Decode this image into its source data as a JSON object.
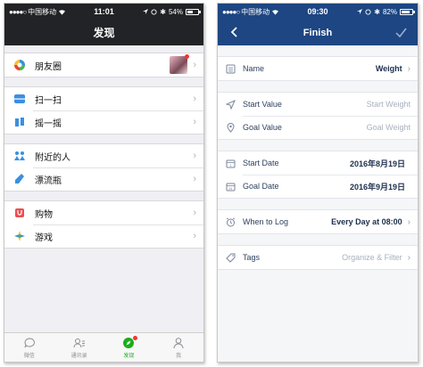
{
  "left_phone": {
    "status": {
      "carrier": "中国移动",
      "time": "11:01",
      "battery": "54%",
      "battery_level": 0.54
    },
    "title": "发现",
    "groups": [
      {
        "items": [
          {
            "label": "朋友圈",
            "icon": "moments-icon",
            "has_avatar": true
          }
        ]
      },
      {
        "items": [
          {
            "label": "扫一扫",
            "icon": "scan-icon"
          },
          {
            "label": "摇一摇",
            "icon": "shake-icon"
          }
        ]
      },
      {
        "items": [
          {
            "label": "附近的人",
            "icon": "nearby-people-icon"
          },
          {
            "label": "漂流瓶",
            "icon": "drift-bottle-icon"
          }
        ]
      },
      {
        "items": [
          {
            "label": "购物",
            "icon": "shopping-icon"
          },
          {
            "label": "游戏",
            "icon": "games-icon"
          }
        ]
      }
    ],
    "tabs": [
      {
        "label": "微信",
        "icon": "chat-bubble-icon",
        "active": false
      },
      {
        "label": "通讯录",
        "icon": "contacts-icon",
        "active": false
      },
      {
        "label": "发现",
        "icon": "compass-icon",
        "active": true,
        "badge": true
      },
      {
        "label": "我",
        "icon": "person-icon",
        "active": false
      }
    ],
    "colors": {
      "nav": "#222326",
      "accent": "#1aad19",
      "badge": "#f43530"
    }
  },
  "right_phone": {
    "status": {
      "carrier": "中国移动",
      "time": "09:30",
      "battery": "82%",
      "battery_level": 0.82
    },
    "title": "Finish",
    "back_icon": "chevron-left-icon",
    "done_icon": "checkmark-icon",
    "name_row": {
      "label": "Name",
      "value": "Weight"
    },
    "start_value": {
      "label": "Start Value",
      "placeholder": "Start Weight"
    },
    "goal_value": {
      "label": "Goal Value",
      "placeholder": "Goal Weight"
    },
    "start_date": {
      "label": "Start Date",
      "value": "2016年8月19日"
    },
    "goal_date": {
      "label": "Goal Date",
      "value": "2016年9月19日"
    },
    "when_to_log": {
      "label": "When to Log",
      "value": "Every Day at 08:00"
    },
    "tags": {
      "label": "Tags",
      "placeholder": "Organize & Filter"
    },
    "colors": {
      "nav": "#1d4682",
      "text": "#1d2f4d",
      "placeholder": "#a9b0bd"
    }
  }
}
